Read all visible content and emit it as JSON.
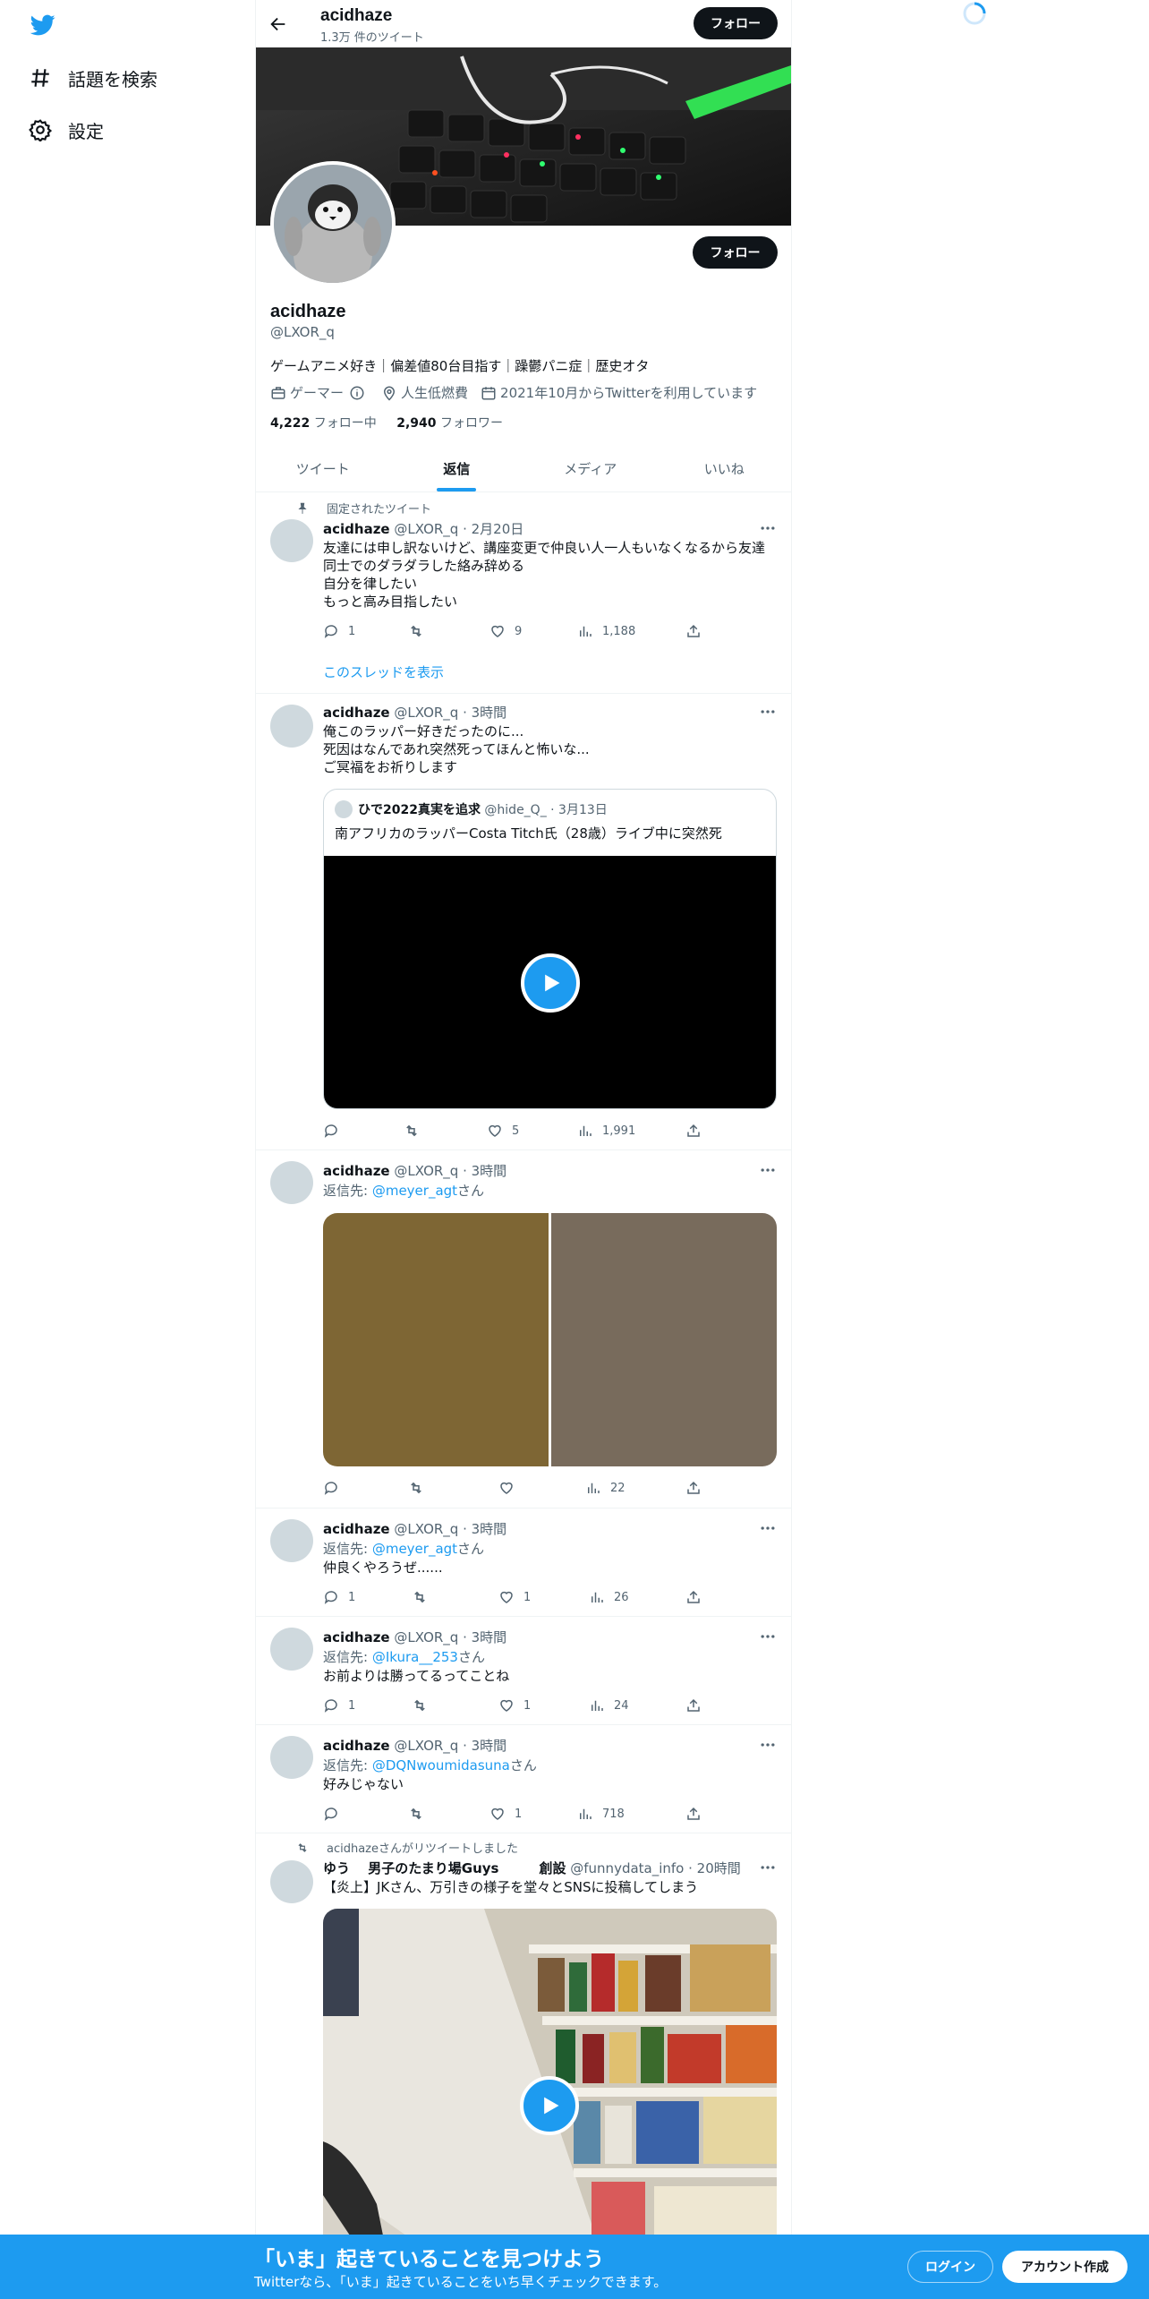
{
  "sidebar": {
    "items": [
      {
        "label": "話題を検索",
        "icon": "hashtag-icon"
      },
      {
        "label": "設定",
        "icon": "gear-icon"
      }
    ]
  },
  "header": {
    "name": "acidhaze",
    "tweet_count": "1.3万 件のツイート",
    "follow_label": "フォロー"
  },
  "profile": {
    "name": "acidhaze",
    "handle": "@LXOR_q",
    "bio": "ゲームアニメ好き｜偏差値80台目指す｜躁鬱パニ症｜歴史オタ",
    "category": "ゲーマー",
    "location": "人生低燃費",
    "joined": "2021年10月からTwitterを利用しています",
    "following_count": "4,222",
    "following_label": "フォロー中",
    "followers_count": "2,940",
    "followers_label": "フォロワー",
    "follow_label": "フォロー"
  },
  "tabs": [
    {
      "label": "ツイート"
    },
    {
      "label": "返信",
      "active": true
    },
    {
      "label": "メディア"
    },
    {
      "label": "いいね"
    }
  ],
  "tweets": [
    {
      "social": "固定されたツイート",
      "name": "acidhaze",
      "meta": "@LXOR_q · 2月20日",
      "lines": [
        "友達には申し訳ないけど、講座変更で仲良い人一人もいなくなるから友達",
        "同士でのダラダラした絡み辞める",
        "自分を律したい",
        "もっと高み目指したい"
      ],
      "replies": "1",
      "retweets": "",
      "likes": "9",
      "views": "1,188",
      "thread_link": "このスレッドを表示"
    },
    {
      "name": "acidhaze",
      "meta": "@LXOR_q · 3時間",
      "lines": [
        "俺このラッパー好きだったのに...",
        "死因はなんであれ突然死ってほんと怖いな...",
        "ご冥福をお祈りします"
      ],
      "quote": {
        "name": "ひで2022真実を追求",
        "meta": "@hide_Q_ · 3月13日",
        "text": "南アフリカのラッパーCosta Titch氏（28歳）ライブ中に突然死"
      },
      "replies": "",
      "retweets": "",
      "likes": "5",
      "views": "1,991"
    },
    {
      "name": "acidhaze",
      "meta": "@LXOR_q · 3時間",
      "reply_prefix": "返信先: ",
      "reply_to": "@meyer_agt",
      "reply_suffix": "さん",
      "media_colors": [
        "#7e6634",
        "#786b5c"
      ],
      "replies": "",
      "retweets": "",
      "likes": "",
      "views": "22"
    },
    {
      "name": "acidhaze",
      "meta": "@LXOR_q · 3時間",
      "reply_prefix": "返信先: ",
      "reply_to": "@meyer_agt",
      "reply_suffix": "さん",
      "lines": [
        "仲良くやろうぜ......"
      ],
      "replies": "1",
      "retweets": "",
      "likes": "1",
      "views": "26"
    },
    {
      "name": "acidhaze",
      "meta": "@LXOR_q · 3時間",
      "reply_prefix": "返信先: ",
      "reply_to": "@Ikura__253",
      "reply_suffix": "さん",
      "lines": [
        "お前よりは勝ってるってことね"
      ],
      "replies": "1",
      "retweets": "",
      "likes": "1",
      "views": "24"
    },
    {
      "name": "acidhaze",
      "meta": "@LXOR_q · 3時間",
      "reply_prefix": "返信先: ",
      "reply_to": "@DQNwoumidasuna",
      "reply_suffix": "さん",
      "lines": [
        "好みじゃない"
      ],
      "replies": "",
      "retweets": "",
      "likes": "1",
      "views": "718"
    },
    {
      "social": "acidhazeさんがリツイートしました",
      "name": "ゆう　 男子のたまり場Guys　　　創設",
      "meta": "@funnydata_info · 20時間",
      "lines": [
        "【炎上】JKさん、万引きの様子を堂々とSNSに投稿してしまう"
      ]
    }
  ],
  "bottom_bar": {
    "title": "「いま」起きていることを見つけよう",
    "subtitle": "Twitterなら、「いま」起きていることをいち早くチェックできます。",
    "login": "ログイン",
    "signup": "アカウント作成"
  },
  "colors": {
    "accent": "#1d9bf0",
    "text": "#0f1419",
    "muted": "#536471"
  }
}
